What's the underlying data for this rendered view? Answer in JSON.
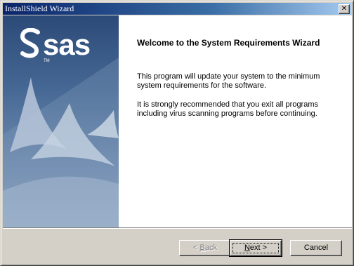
{
  "window": {
    "title": "InstallShield Wizard",
    "close_glyph": "✕"
  },
  "side_panel": {
    "logo_text": "sas",
    "logo_tm": "TM",
    "logo_icon": "sas-logo-icon"
  },
  "main": {
    "heading": "Welcome to the System Requirements Wizard",
    "paragraph1": "This program will update your system to the minimum system requirements for the software.",
    "paragraph2": "It is strongly recommended that you exit all programs including virus scanning programs before continuing."
  },
  "buttons": {
    "back": {
      "mnemonic": "B",
      "rest": "ack",
      "prefix": "< ",
      "enabled": false
    },
    "next": {
      "mnemonic": "N",
      "rest": "ext",
      "suffix": " >",
      "enabled": true
    },
    "cancel": {
      "label": "Cancel",
      "enabled": true
    }
  },
  "colors": {
    "titlebar_start": "#0a246a",
    "titlebar_end": "#a6caf0",
    "dialog_face": "#d4d0c8",
    "side_panel_top": "#2c4a78",
    "side_panel_bottom": "#93a9c4"
  }
}
